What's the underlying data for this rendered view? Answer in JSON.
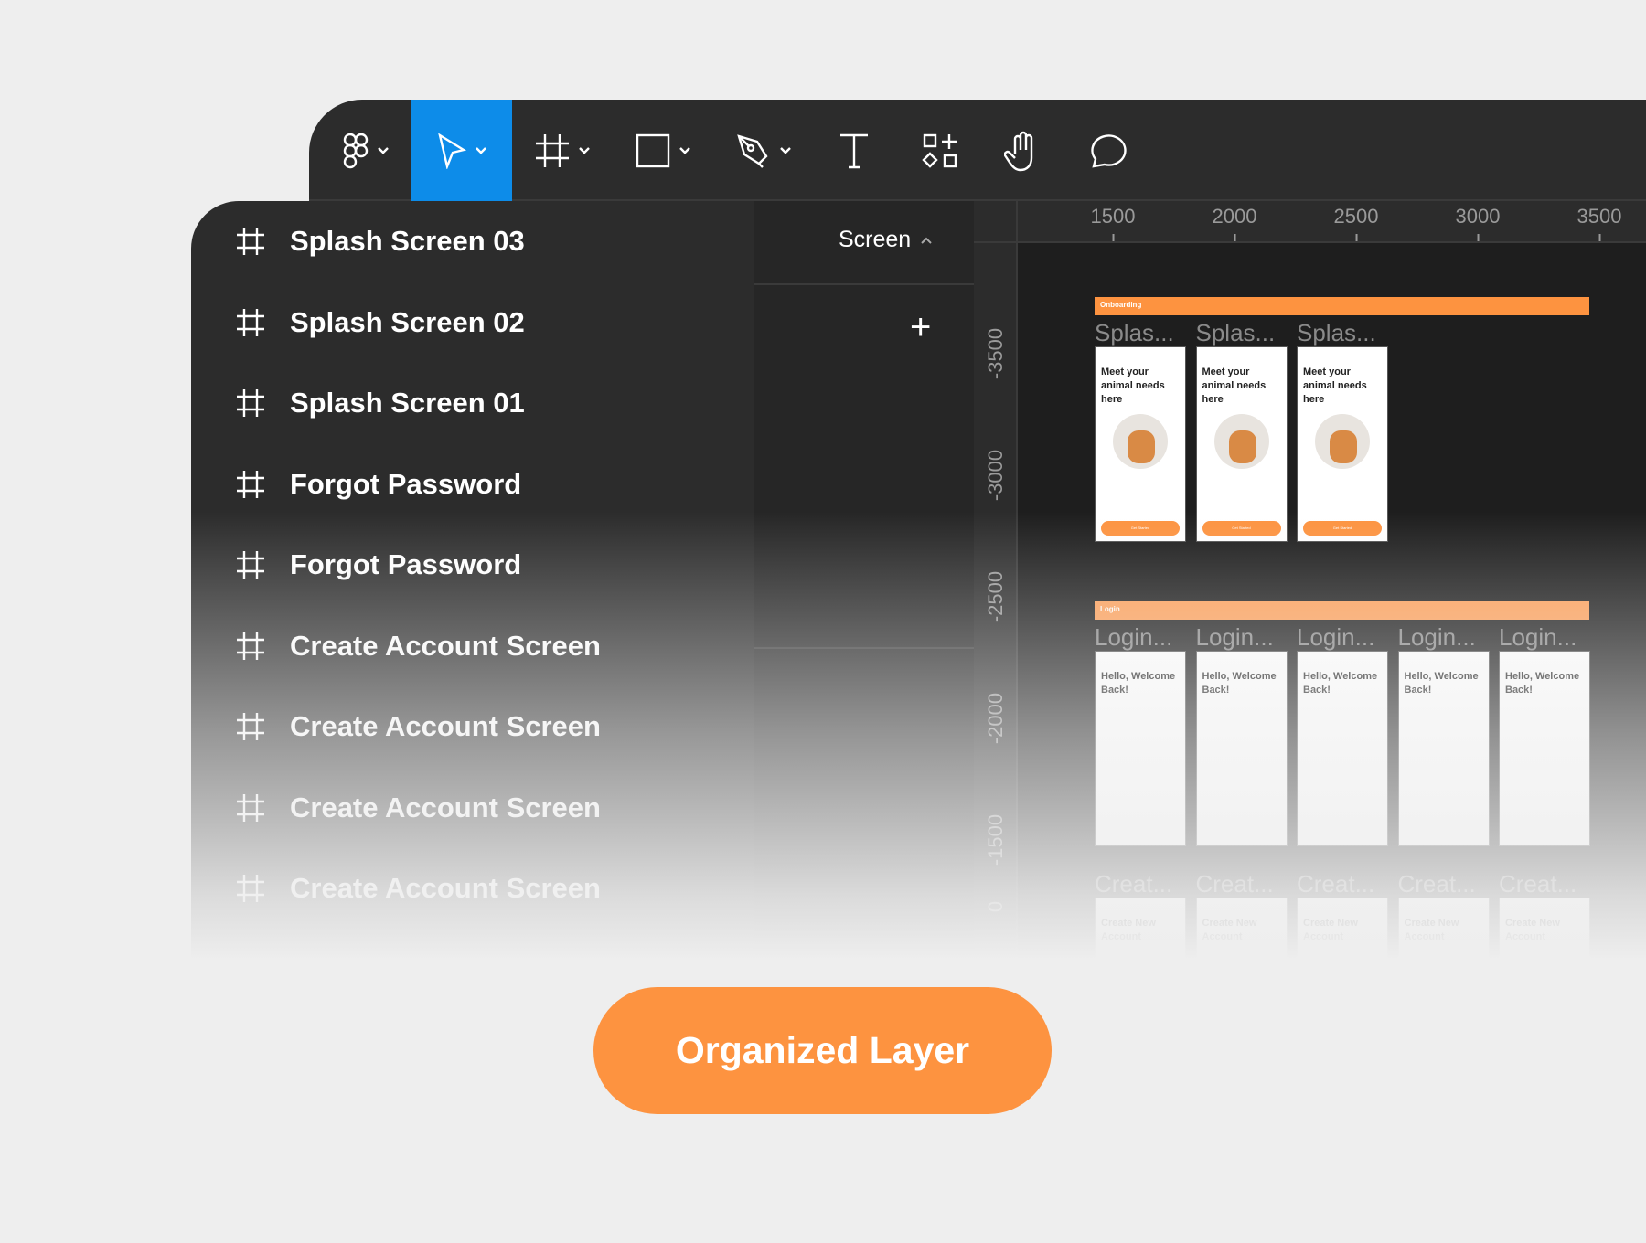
{
  "toolbar": {
    "tools": [
      {
        "name": "figma-menu",
        "icon": "figma-logo-icon",
        "has_dropdown": true
      },
      {
        "name": "move",
        "icon": "cursor-arrow-icon",
        "has_dropdown": true,
        "active": true
      },
      {
        "name": "frame",
        "icon": "frame-hash-icon",
        "has_dropdown": true
      },
      {
        "name": "rectangle",
        "icon": "rectangle-icon",
        "has_dropdown": true
      },
      {
        "name": "pen",
        "icon": "pen-icon",
        "has_dropdown": true
      },
      {
        "name": "text",
        "icon": "text-icon",
        "has_dropdown": false
      },
      {
        "name": "resources",
        "icon": "components-icon",
        "has_dropdown": false
      },
      {
        "name": "hand",
        "icon": "hand-icon",
        "has_dropdown": false
      },
      {
        "name": "comment",
        "icon": "comment-icon",
        "has_dropdown": false
      }
    ],
    "active_color": "#0d8ce9"
  },
  "layers": {
    "page_selector": "Screen",
    "add_label": "+",
    "items": [
      {
        "label": "Splash Screen 03"
      },
      {
        "label": "Splash Screen 02"
      },
      {
        "label": "Splash Screen 01"
      },
      {
        "label": "Forgot Password"
      },
      {
        "label": "Forgot Password"
      },
      {
        "label": "Create Account Screen"
      },
      {
        "label": "Create Account Screen"
      },
      {
        "label": "Create Account Screen"
      },
      {
        "label": "Create Account Screen"
      }
    ]
  },
  "canvas": {
    "ruler_x": [
      "1500",
      "2000",
      "2500",
      "3000",
      "3500"
    ],
    "ruler_y": [
      "-3500",
      "-3000",
      "-2500",
      "-2000",
      "-1500",
      "0"
    ],
    "sections": [
      {
        "title": "Onboarding",
        "frame_label": "Splas...",
        "frames": [
          {
            "heading": "Meet your animal needs here",
            "button": "Get Started"
          },
          {
            "heading": "Meet your animal needs here",
            "button": "Get Started"
          },
          {
            "heading": "Meet your animal needs here",
            "button": "Get Started"
          }
        ]
      },
      {
        "title": "Login",
        "frame_label": "Login...",
        "frames": [
          {
            "heading": "Hello, Welcome Back!"
          },
          {
            "heading": "Hello, Welcome Back!"
          },
          {
            "heading": "Hello, Welcome Back!"
          },
          {
            "heading": "Hello, Welcome Back!"
          },
          {
            "heading": "Hello, Welcome Back!"
          }
        ]
      },
      {
        "title": "",
        "frame_label": "Creat...",
        "frames": [
          {
            "heading": "Create New Account"
          },
          {
            "heading": "Create New Account"
          },
          {
            "heading": "Create New Account"
          },
          {
            "heading": "Create New Account"
          },
          {
            "heading": "Create New Account"
          }
        ]
      }
    ],
    "accent": "#fd9340"
  },
  "cta": {
    "label": "Organized Layer",
    "color": "#fd9340"
  }
}
